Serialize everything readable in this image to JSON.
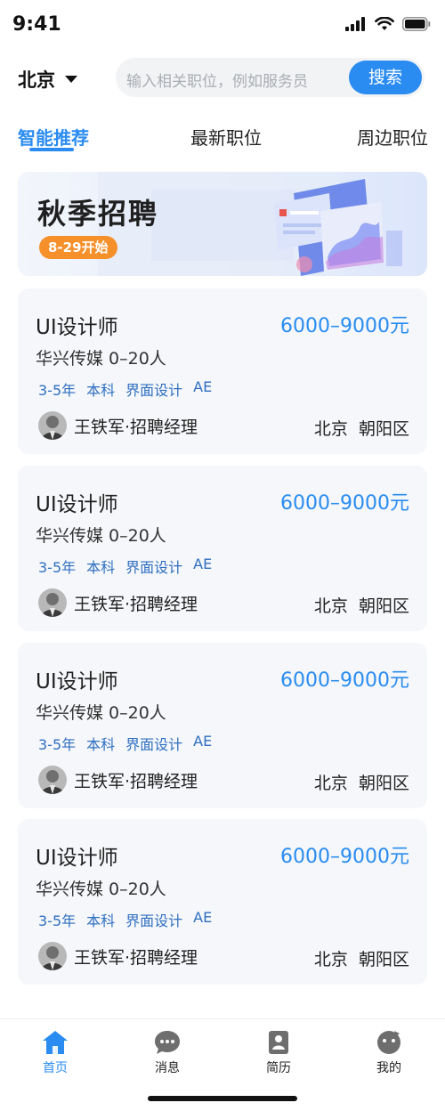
{
  "status_bar": {
    "time": "9:41"
  },
  "header": {
    "city": "北京",
    "search_placeholder": "输入相关职位，例如服务员",
    "search_button": "搜索"
  },
  "tabs": [
    {
      "label": "智能推荐",
      "active": true
    },
    {
      "label": "最新职位",
      "active": false
    },
    {
      "label": "周边职位",
      "active": false
    }
  ],
  "banner": {
    "title": "秋季招聘",
    "badge": "8-29开始"
  },
  "jobs": [
    {
      "title": "UI设计师",
      "salary": "6000–9000元",
      "company": "华兴传媒 0–20人",
      "tags": [
        "3-5年",
        "本科",
        "界面设计",
        "AE"
      ],
      "recruiter": "王铁军·招聘经理",
      "city": "北京",
      "district": "朝阳区"
    },
    {
      "title": "UI设计师",
      "salary": "6000–9000元",
      "company": "华兴传媒 0–20人",
      "tags": [
        "3-5年",
        "本科",
        "界面设计",
        "AE"
      ],
      "recruiter": "王铁军·招聘经理",
      "city": "北京",
      "district": "朝阳区"
    },
    {
      "title": "UI设计师",
      "salary": "6000–9000元",
      "company": "华兴传媒 0–20人",
      "tags": [
        "3-5年",
        "本科",
        "界面设计",
        "AE"
      ],
      "recruiter": "王铁军·招聘经理",
      "city": "北京",
      "district": "朝阳区"
    },
    {
      "title": "UI设计师",
      "salary": "6000–9000元",
      "company": "华兴传媒 0–20人",
      "tags": [
        "3-5年",
        "本科",
        "界面设计",
        "AE"
      ],
      "recruiter": "王铁军·招聘经理",
      "city": "北京",
      "district": "朝阳区"
    }
  ],
  "bottom_nav": [
    {
      "label": "首页",
      "icon": "home-icon",
      "active": true
    },
    {
      "label": "消息",
      "icon": "message-icon",
      "active": false
    },
    {
      "label": "简历",
      "icon": "resume-icon",
      "active": false
    },
    {
      "label": "我的",
      "icon": "profile-icon",
      "active": false
    }
  ],
  "colors": {
    "accent": "#2a8cf0",
    "badge": "#f5902a",
    "tag": "#2f6fc0",
    "card_bg": "#f5f7fa"
  }
}
